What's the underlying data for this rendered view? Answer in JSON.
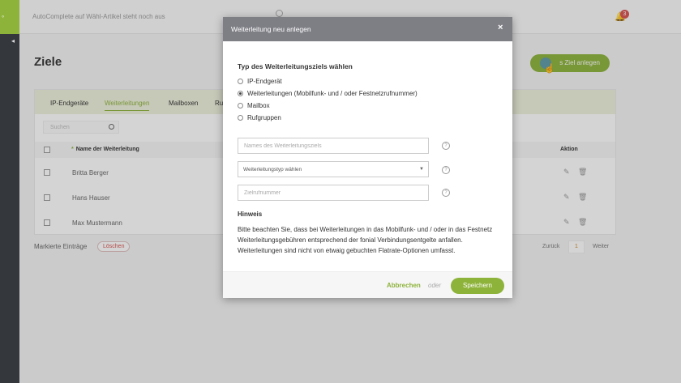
{
  "app": {
    "autocomplete_notice": "AutoComplete auf Wähl-Artikel steht noch aus",
    "notification_count": "3"
  },
  "page": {
    "title": "Ziele",
    "new_button": "s Ziel anlegen",
    "tabs": [
      "IP-Endgeräte",
      "Weiterleitungen",
      "Mailboxen",
      "Ru"
    ],
    "active_tab": "Weiterleitungen",
    "search_placeholder": "Suchen",
    "columns": {
      "name": "Name der Weiterleitung",
      "action": "Aktion"
    },
    "rows": [
      "Britta Berger",
      "Hans Hauser",
      "Max Mustermann"
    ],
    "marked_label": "Markierte Einträge",
    "delete_label": "Löschen",
    "pager": {
      "back": "Zurück",
      "page": "1",
      "next": "Weiter"
    }
  },
  "modal": {
    "title": "Weiterleitung neu anlegen",
    "close": "×",
    "section_label": "Typ des Weiterleitungsziels wählen",
    "options": [
      {
        "label": "IP-Endgerät",
        "checked": false
      },
      {
        "label": "Weiterleitungen (Mobilfunk- und / oder Festnetzrufnummer)",
        "checked": true
      },
      {
        "label": "Mailbox",
        "checked": false
      },
      {
        "label": "Rufgruppen",
        "checked": false
      }
    ],
    "name_placeholder": "Names des Weiterleitungsziels",
    "type_select": "Weiterleitungstyp wählen",
    "number_placeholder": "Zielrufnummer",
    "help": "?",
    "hint_title": "Hinweis",
    "hint_text": "Bitte beachten Sie, dass bei Weiterleitungen in das Mobilfunk- und / oder in das Festnetz Weiterleitungsgebühren entsprechend der fonial Verbindungsentgelte anfallen. Weiterleitungen sind nicht von etwaig gebuchten Flatrate-Optionen umfasst.",
    "cancel": "Abbrechen",
    "or": "oder",
    "save": "Speichern"
  },
  "colors": {
    "accent": "#8db33a",
    "header": "#7e7f85",
    "rail": "#34383d"
  }
}
